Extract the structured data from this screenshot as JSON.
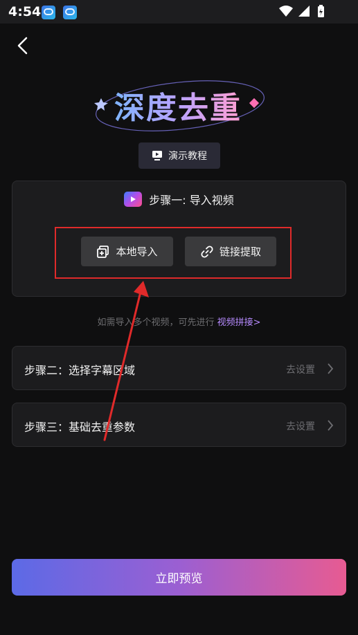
{
  "status": {
    "time": "4:54"
  },
  "header": {
    "logo_text": "深度去重",
    "tutorial_label": "演示教程"
  },
  "step1": {
    "title": "步骤一: 导入视频",
    "local_import": "本地导入",
    "link_extract": "链接提取"
  },
  "hint": {
    "text": "如需导入多个视频，可先进行",
    "link": "视频拼接>"
  },
  "steps": [
    {
      "label": "步骤二：选择字幕区域",
      "action": "去设置"
    },
    {
      "label": "步骤三：基础去重参数",
      "action": "去设置"
    }
  ],
  "preview_label": "立即预览",
  "colors": {
    "accent_start": "#5c6ae6",
    "accent_end": "#e75b92",
    "highlight": "#e02a2a",
    "hint_link": "#b78bff"
  }
}
